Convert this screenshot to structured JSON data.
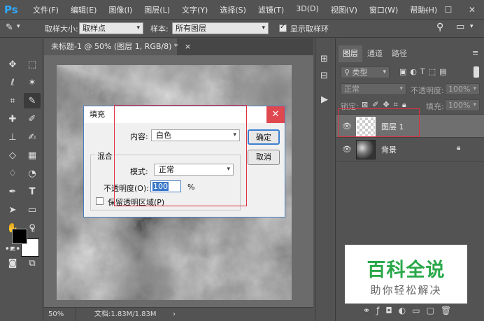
{
  "app": {
    "logo": "Ps"
  },
  "menu": [
    "文件(F)",
    "编辑(E)",
    "图像(I)",
    "图层(L)",
    "文字(Y)",
    "选择(S)",
    "滤镜(T)",
    "3D(D)",
    "视图(V)",
    "窗口(W)",
    "帮助(H)"
  ],
  "options": {
    "sample_size_label": "取样大小:",
    "sample_size_value": "取样点",
    "sample_label": "样本:",
    "sample_value": "所有图层",
    "show_ring_label": "显示取样环"
  },
  "document": {
    "tab_title": "未标题-1 @ 50% (图层 1, RGB/8) *",
    "tab_close": "×",
    "zoom": "50%",
    "doc_size": "文档:1.83M/1.83M"
  },
  "layers_panel": {
    "tabs": [
      "图层",
      "通道",
      "路径"
    ],
    "kind_filter": "类型",
    "blend_mode": "正常",
    "opacity_label": "不透明度:",
    "opacity_value": "100%",
    "lock_label": "锁定:",
    "fill_label": "填充:",
    "fill_value": "100%",
    "layers": [
      {
        "name": "图层 1",
        "selected": true
      },
      {
        "name": "背景",
        "selected": false
      }
    ]
  },
  "fill_dialog": {
    "title": "填充",
    "content_label": "内容:",
    "content_value": "白色",
    "ok_label": "确定",
    "cancel_label": "取消",
    "blend_group_label": "混合",
    "mode_label": "模式:",
    "mode_value": "正常",
    "opacity_label": "不透明度(O):",
    "opacity_value": "100",
    "opacity_unit": "%",
    "preserve_label": "保留透明区域(P)"
  },
  "watermark": {
    "main": "百科全说",
    "sub": "助你轻松解决"
  },
  "colors": {
    "accent": "#31a8ff",
    "close_red": "#e04850",
    "annotation_red": "#e03040",
    "watermark_green": "#2aa84a"
  }
}
